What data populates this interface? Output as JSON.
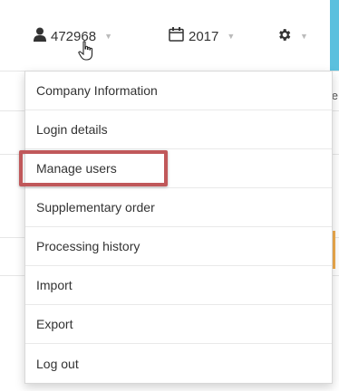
{
  "header": {
    "user_id": "472968",
    "year": "2017",
    "accent_color": "#5bc0de",
    "icons": {
      "user": "user-icon",
      "calendar": "calendar-icon",
      "settings": "gear-icon",
      "pointer": "hand-pointer-icon"
    }
  },
  "background": {
    "edge_text": "te"
  },
  "menu": {
    "items": [
      {
        "label": "Company Information"
      },
      {
        "label": "Login details"
      },
      {
        "label": "Manage users"
      },
      {
        "label": "Supplementary order"
      },
      {
        "label": "Processing history"
      },
      {
        "label": "Import"
      },
      {
        "label": "Export"
      },
      {
        "label": "Log out"
      }
    ],
    "highlighted_item": "Manage users",
    "highlight_color": "#c0585a"
  }
}
